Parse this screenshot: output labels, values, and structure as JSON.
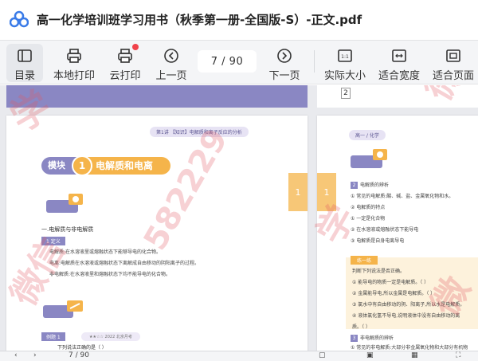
{
  "window": {
    "title": "高一化学培训班学习用书（秋季第一册-全国版-S）-正文.pdf"
  },
  "toolbar": {
    "items": [
      {
        "label": "目录",
        "icon": "toc-icon"
      },
      {
        "label": "本地打印",
        "icon": "printer-icon"
      },
      {
        "label": "云打印",
        "icon": "cloud-print-icon"
      },
      {
        "label": "上一页",
        "icon": "prev-page-icon"
      },
      {
        "label": "下一页",
        "icon": "next-page-icon"
      },
      {
        "label": "实际大小",
        "icon": "actual-size-icon"
      },
      {
        "label": "适合宽度",
        "icon": "fit-width-icon"
      },
      {
        "label": "适合页面",
        "icon": "fit-page-icon"
      }
    ],
    "page_indicator": "7  /  90",
    "actual_size_glyph": "1:1"
  },
  "left_page": {
    "header_pill": "第1讲 【知识】电解质和离子反应的分析",
    "module_prefix": "模块",
    "module_number": "1",
    "module_title": "电解质和电离",
    "section_title": "一.电解质与非电解质",
    "def_label": "1  定义",
    "paragraphs": [
      "电解质:在水溶液里或熔融状态下能够导电的化合物。",
      "电离:电解质在水溶液或熔融状态下离解成自由移动的阴阳离子的过程。",
      "非电解质:在水溶液里和熔融状态下均不能导电的化合物。"
    ],
    "example_label": "例题 1",
    "example_meta": "★★☆☆  2022 北京月考",
    "example_question": "下列说法正确的是（    ）",
    "side_tab": "1"
  },
  "right_page": {
    "page_box": "2",
    "header_pill": "高一 / 化学",
    "side_tab": "1",
    "lines": [
      {
        "num": "2",
        "text": "电解质的辨析"
      },
      {
        "num": "",
        "text": "① 常见的电解质:酸、碱、盐、金属氧化物和水。"
      },
      {
        "num": "",
        "text": "② 电解质的特点"
      },
      {
        "num": "",
        "text": "① 一定是化合物"
      },
      {
        "num": "",
        "text": "② 在水溶液或熔融状态下能导电"
      },
      {
        "num": "",
        "text": "③ 电解质是自身电离导电"
      }
    ],
    "practice_label": "练一练",
    "practice_lines": [
      "判断下列说法是否正确。",
      "① 能导电的物质一定是电解质。（    ）",
      "② 金属能导电,所以金属是电解质。（    ）",
      "③ 氯水中有自由移动的阴、阳离子,所以水是电解质。",
      "④ 液体氯化氢不导电,说明液体中没有自由移动的离",
      "质。（    ）"
    ],
    "non_electrolyte": [
      {
        "num": "3",
        "text": "非电解质的辨析"
      },
      {
        "num": "",
        "text": "① 常见的非电解质:大部分非金属氧化物和大部分有机物"
      }
    ]
  },
  "watermarks": {
    "phone": "582229",
    "text_a": "学",
    "text_b": "微信",
    "text_c": "学",
    "text_d": "微信",
    "text_e": "微"
  },
  "bottom_bar": {
    "page": "7 / 90"
  },
  "colors": {
    "accent_purple": "#8a87c3",
    "accent_orange": "#f5b44a",
    "red_dot": "#f0424a"
  }
}
